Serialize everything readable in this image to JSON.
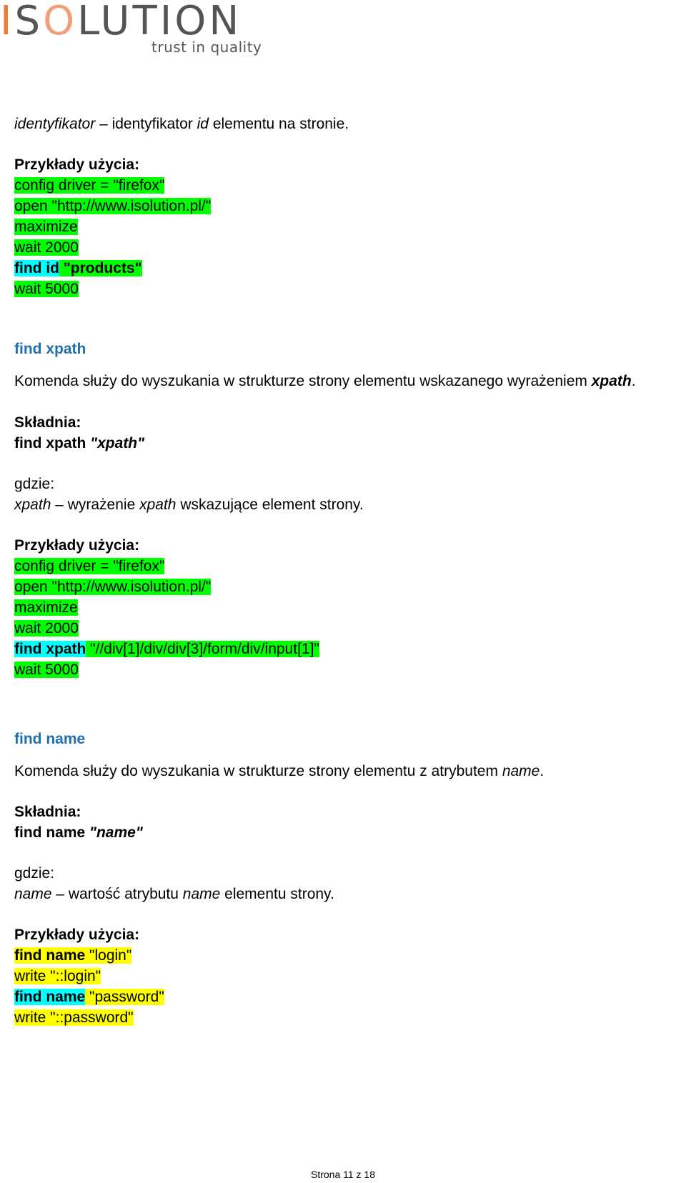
{
  "logo": {
    "word_accent": "I",
    "word_rest_1": "S",
    "word_o": "O",
    "word_rest_2": "LUTION",
    "tagline": "trust in quality"
  },
  "sections": {
    "find_id_tail": {
      "def_term": "identyfikator",
      "def_sep": " – identyfikator ",
      "def_term2": "id",
      "def_rest": " elementu na stronie.",
      "examples_label": "Przykłady użycia:",
      "examples": [
        "config driver = \"firefox\"",
        "open \"http://www.isolution.pl/\"",
        "maximize",
        "wait 2000",
        {
          "cmd": "find id",
          "arg": " \"products\""
        },
        "wait 5000"
      ]
    },
    "find_xpath": {
      "heading": "find xpath",
      "desc_text": "Komenda służy do wyszukania w strukturze strony elementu wskazanego wyrażeniem ",
      "desc_term": "xpath",
      "desc_end": ".",
      "syntax_label": "Składnia:",
      "syntax_cmd": "find xpath ",
      "syntax_arg": "\"xpath\"",
      "where_label": "gdzie:",
      "where_term": "xpath",
      "where_sep": " – wyrażenie ",
      "where_term2": "xpath",
      "where_rest": " wskazujące element strony.",
      "examples_label": "Przykłady użycia:",
      "examples": [
        "config driver = \"firefox\"",
        "open \"http://www.isolution.pl/\"",
        "maximize",
        "wait 2000",
        {
          "cmd": "find xpath",
          "arg": " \"//div[1]/div/div[3]/form/div/input[1]\""
        },
        "wait 5000"
      ]
    },
    "find_name": {
      "heading": "find name",
      "desc_text": "Komenda służy do wyszukania w strukturze strony elementu z atrybutem ",
      "desc_term": "name",
      "desc_end": ".",
      "syntax_label": "Składnia:",
      "syntax_cmd": "find name ",
      "syntax_arg": "\"name\"",
      "where_label": "gdzie:",
      "where_term": "name",
      "where_sep": " – wartość atrybutu ",
      "where_term2": "name",
      "where_rest": " elementu strony.",
      "examples_label": "Przykłady użycia:",
      "examples": [
        {
          "cmd": "find name",
          "arg": " \"login\""
        },
        "write \"::login\"",
        {
          "cmd": "find name",
          "arg": " \"password\""
        },
        "write \"::password\""
      ]
    }
  },
  "colors": {
    "heading": "#1f6fb0",
    "highlight_green": "#00ff00",
    "highlight_cyan": "#00ffff",
    "highlight_yellow": "#ffff00",
    "logo_accent": "#f07a3a"
  },
  "footer": {
    "page_label": "Strona 11 z 18"
  }
}
